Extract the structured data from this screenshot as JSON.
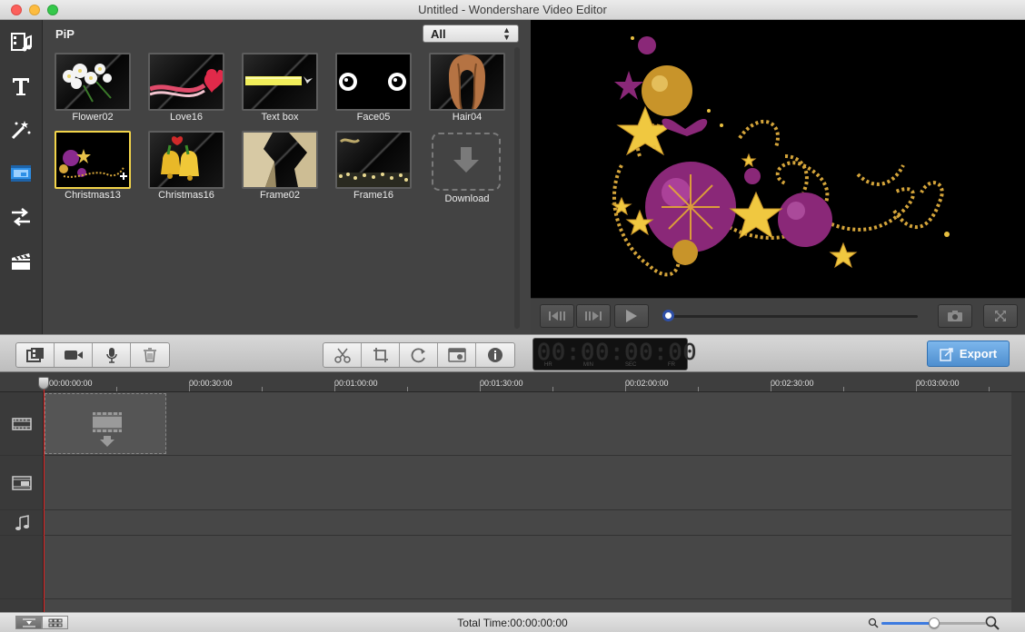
{
  "window": {
    "title": "Untitled - Wondershare Video Editor"
  },
  "sidebar": {
    "items": [
      {
        "icon": "media-icon"
      },
      {
        "icon": "text-icon"
      },
      {
        "icon": "effects-icon"
      },
      {
        "icon": "pip-icon"
      },
      {
        "icon": "transition-icon"
      },
      {
        "icon": "intro-credit-icon"
      }
    ]
  },
  "pip": {
    "title": "PiP",
    "filter": "All",
    "items": [
      {
        "label": "Flower02"
      },
      {
        "label": "Love16"
      },
      {
        "label": "Text box"
      },
      {
        "label": "Face05"
      },
      {
        "label": "Hair04"
      },
      {
        "label": "Christmas13"
      },
      {
        "label": "Christmas16"
      },
      {
        "label": "Frame02"
      },
      {
        "label": "Frame16"
      },
      {
        "label": "Download"
      }
    ]
  },
  "player": {
    "progress": 0
  },
  "timecode": {
    "digits": "00:00:00:00",
    "hr": "HR",
    "min": "MIN",
    "sec": "SEC",
    "fr": "FR"
  },
  "toolbar": {
    "export_label": "Export"
  },
  "ruler": {
    "ticks": [
      "00:00:00:00",
      "00:00:30:00",
      "00:01:00:00",
      "00:01:30:00",
      "00:02:00:00",
      "00:02:30:00",
      "00:03:00:00"
    ]
  },
  "status": {
    "total_time": "Total Time:00:00:00:00",
    "zoom": 0.5
  }
}
